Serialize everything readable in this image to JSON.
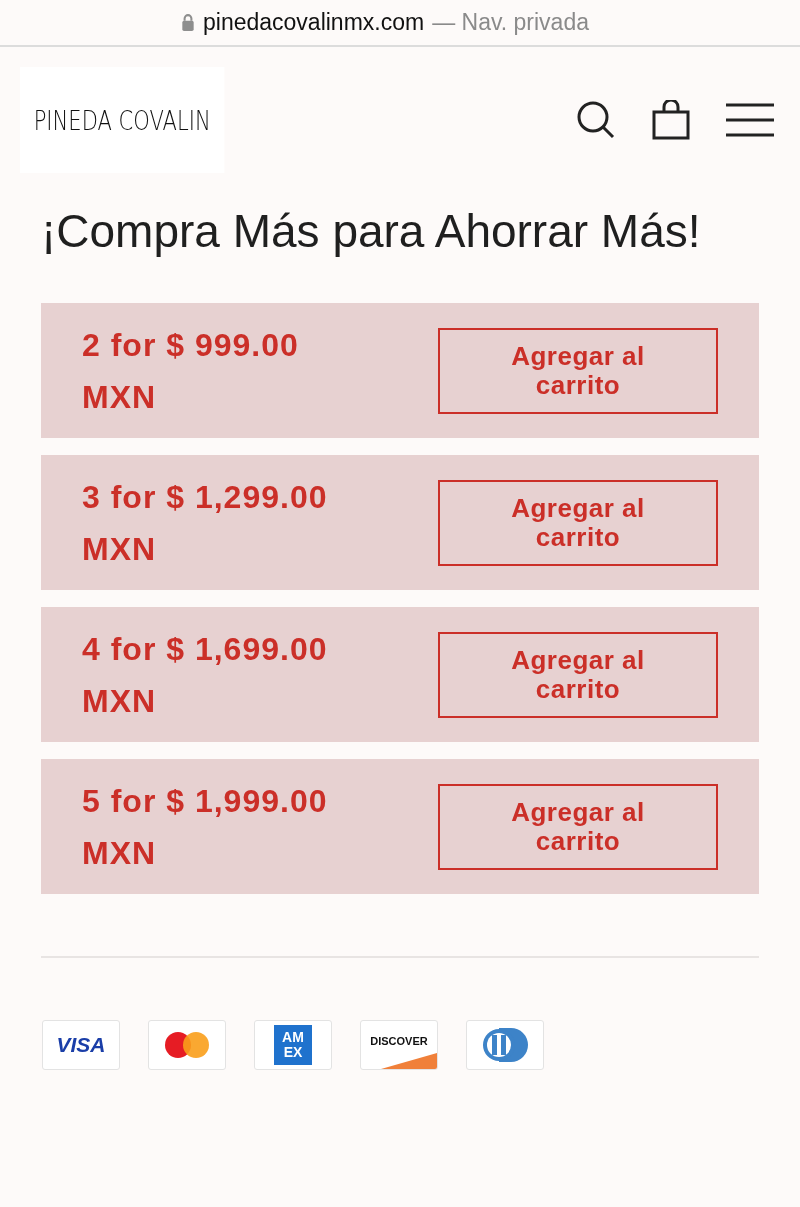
{
  "address_bar": {
    "url": "pinedacovalinmx.com",
    "suffix": "— Nav. privada"
  },
  "header": {
    "logo": "PINEDA COVALIN"
  },
  "heading": "¡Compra Más para Ahorrar Más!",
  "offers": [
    {
      "price": "2 for $ 999.00 MXN",
      "button": "Agregar al carrito"
    },
    {
      "price": "3 for $ 1,299.00 MXN",
      "button": "Agregar al carrito"
    },
    {
      "price": "4 for $ 1,699.00 MXN",
      "button": "Agregar al carrito"
    },
    {
      "price": "5 for $ 1,999.00 MXN",
      "button": "Agregar al carrito"
    }
  ],
  "payment_methods": [
    {
      "kind": "visa",
      "label": "VISA"
    },
    {
      "kind": "mastercard"
    },
    {
      "kind": "amex",
      "lines": [
        "AM",
        "EX"
      ]
    },
    {
      "kind": "discover",
      "label": "DISCOVER"
    },
    {
      "kind": "diners"
    }
  ]
}
